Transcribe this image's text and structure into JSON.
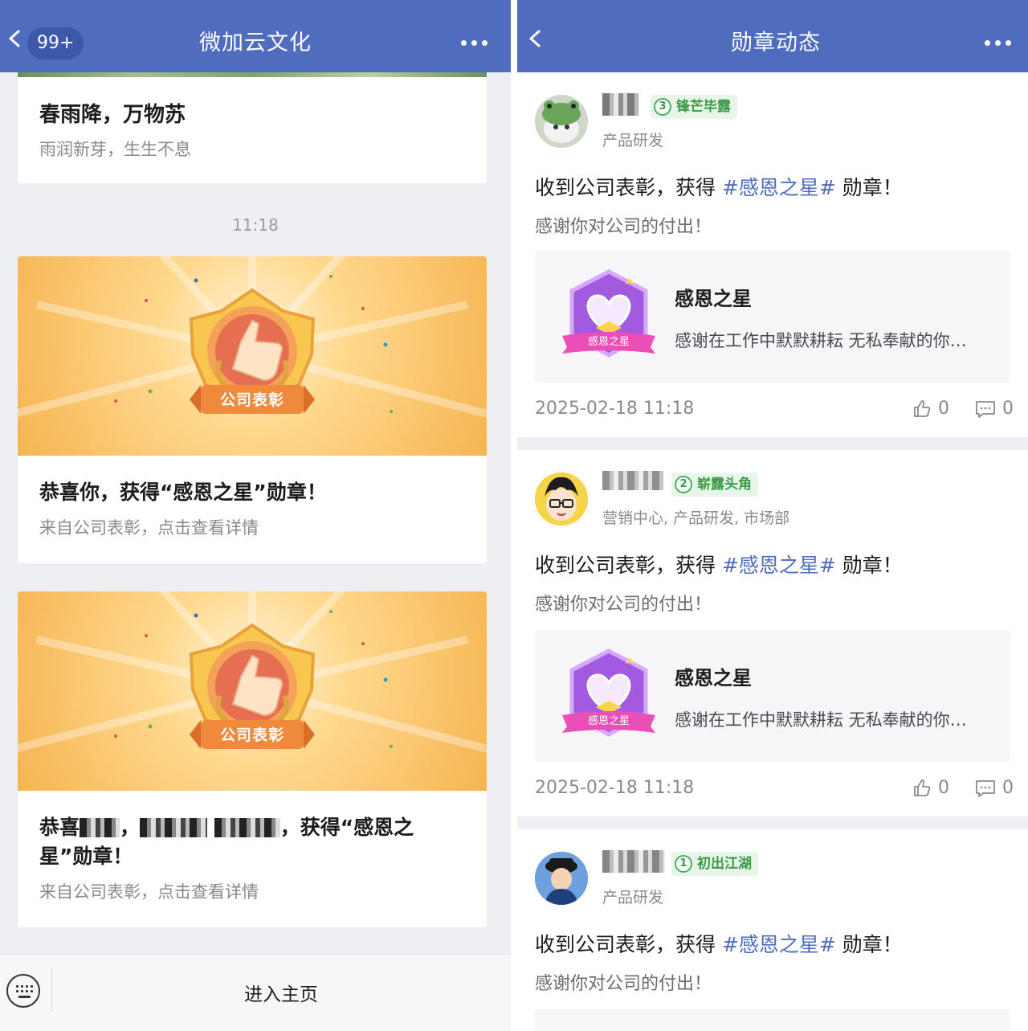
{
  "left": {
    "nav": {
      "title": "微加云文化",
      "badge": "99+"
    },
    "first_card": {
      "title": "春雨降，万物苏",
      "subtitle": "雨润新芽，生生不息"
    },
    "timestamp": "11:18",
    "award_cards": [
      {
        "image_label": "公司表彰",
        "text": "恭喜你，获得“感恩之星”勋章！",
        "from": "来自公司表彰，点击查看详情"
      },
      {
        "image_label": "公司表彰",
        "text_prefix": "恭喜",
        "text_suffix": "，获得“感恩之星”勋章！",
        "from": "来自公司表彰，点击查看详情"
      }
    ],
    "bottom": {
      "home_label": "进入主页"
    }
  },
  "right": {
    "nav": {
      "title": "勋章动态"
    },
    "posts": [
      {
        "level_num": "3",
        "level_name": "锋芒毕露",
        "dept": "产品研发",
        "main_prefix": "收到公司表彰，获得 ",
        "tag": "#感恩之星#",
        "main_suffix": " 勋章！",
        "sub": "感谢你对公司的付出！",
        "medal_name": "感恩之星",
        "medal_ribbon": "感恩之星",
        "medal_desc": "感谢在工作中默默耕耘 无私奉献的你…",
        "time": "2025-02-18 11:18",
        "likes": "0",
        "comments": "0"
      },
      {
        "level_num": "2",
        "level_name": "崭露头角",
        "dept": "营销中心, 产品研发, 市场部",
        "main_prefix": "收到公司表彰，获得 ",
        "tag": "#感恩之星#",
        "main_suffix": " 勋章！",
        "sub": "感谢你对公司的付出！",
        "medal_name": "感恩之星",
        "medal_ribbon": "感恩之星",
        "medal_desc": "感谢在工作中默默耕耘 无私奉献的你…",
        "time": "2025-02-18 11:18",
        "likes": "0",
        "comments": "0"
      },
      {
        "level_num": "1",
        "level_name": "初出江湖",
        "dept": "产品研发",
        "main_prefix": "收到公司表彰，获得 ",
        "tag": "#感恩之星#",
        "main_suffix": " 勋章！",
        "sub": "感谢你对公司的付出！"
      }
    ]
  },
  "colors": {
    "nav_blue": "#4f6cbf",
    "tag_blue": "#4f6cbf",
    "level_green": "#3a9a4a",
    "award_orange": "#f6b450"
  }
}
